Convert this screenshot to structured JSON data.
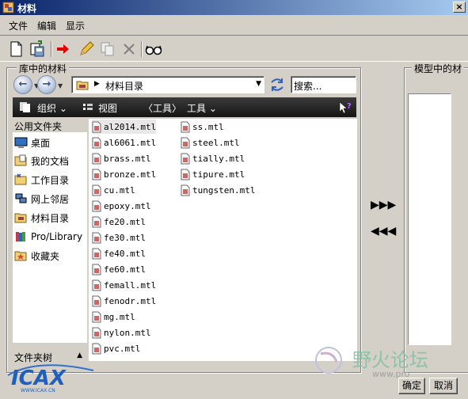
{
  "window": {
    "title": "材料"
  },
  "menu": {
    "items": [
      "文件",
      "编辑",
      "显示"
    ]
  },
  "library": {
    "group_label": "库中的材料",
    "address": {
      "path": "材料目录"
    },
    "search": {
      "placeholder": "搜索..."
    },
    "command_bar": {
      "organize": "组织",
      "views": "视图",
      "tools_bracket": "〈工具〉",
      "tools": "工具"
    },
    "left": {
      "header": "公用文件夹",
      "items": [
        "桌面",
        "我的文档",
        "工作目录",
        "网上邻居",
        "材料目录",
        "Pro/Library",
        "收藏夹"
      ],
      "footer": "文件夹树"
    },
    "files_col1": [
      "al2014.mtl",
      "al6061.mtl",
      "brass.mtl",
      "bronze.mtl",
      "cu.mtl",
      "epoxy.mtl",
      "fe20.mtl",
      "fe30.mtl",
      "fe40.mtl",
      "fe60.mtl",
      "femall.mtl",
      "fenodr.mtl",
      "mg.mtl",
      "nylon.mtl",
      "pvc.mtl"
    ],
    "files_col2": [
      "ss.mtl",
      "steel.mtl",
      "tially.mtl",
      "tipure.mtl",
      "tungsten.mtl"
    ]
  },
  "model": {
    "group_label": "模型中的材"
  },
  "transfer": {
    "add": "▶▶▶",
    "remove": "◀◀◀"
  },
  "buttons": {
    "ok": "确定",
    "cancel": "取消"
  },
  "watermark": {
    "left": "ICAX",
    "left_url": "WWW.ICAX.CN",
    "right": "野火论坛",
    "right_url": "www.pro"
  },
  "colors": {
    "title_start": "#0a246a",
    "title_end": "#a6caf0",
    "dark_bar": "#1e1e1e",
    "window_bg": "#d4d0c8"
  }
}
